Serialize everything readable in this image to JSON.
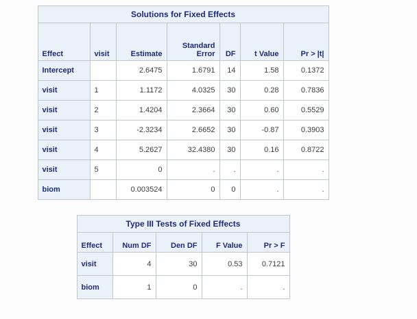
{
  "theme": {
    "header_bg": "#ebf1f8",
    "header_text": "#1b2a7b",
    "data_text": "#3b3b3f",
    "border": "#bfc6cd",
    "page_bg": "#fcfcfd"
  },
  "tables": [
    {
      "title": "Solutions for Fixed Effects",
      "columns": [
        "Effect",
        "visit",
        "Estimate",
        "Standard\nError",
        "DF",
        "t Value",
        "Pr > |t|"
      ],
      "rows": [
        [
          "Intercept",
          "",
          "2.6475",
          "1.6791",
          "14",
          "1.58",
          "0.1372"
        ],
        [
          "visit",
          "1",
          "1.1172",
          "4.0325",
          "30",
          "0.28",
          "0.7836"
        ],
        [
          "visit",
          "2",
          "1.4204",
          "2.3664",
          "30",
          "0.60",
          "0.5529"
        ],
        [
          "visit",
          "3",
          "-2.3234",
          "2.6652",
          "30",
          "-0.87",
          "0.3903"
        ],
        [
          "visit",
          "4",
          "5.2627",
          "32.4380",
          "30",
          "0.16",
          "0.8722"
        ],
        [
          "visit",
          "5",
          "0",
          ".",
          ".",
          ".",
          "."
        ],
        [
          "biom",
          "",
          "0.003524",
          "0",
          "0",
          ".",
          "."
        ]
      ]
    },
    {
      "title": "Type III Tests of Fixed Effects",
      "columns": [
        "Effect",
        "Num DF",
        "Den DF",
        "F Value",
        "Pr > F"
      ],
      "rows": [
        [
          "visit",
          "4",
          "30",
          "0.53",
          "0.7121"
        ],
        [
          "biom",
          "1",
          "0",
          ".",
          "."
        ]
      ]
    }
  ]
}
